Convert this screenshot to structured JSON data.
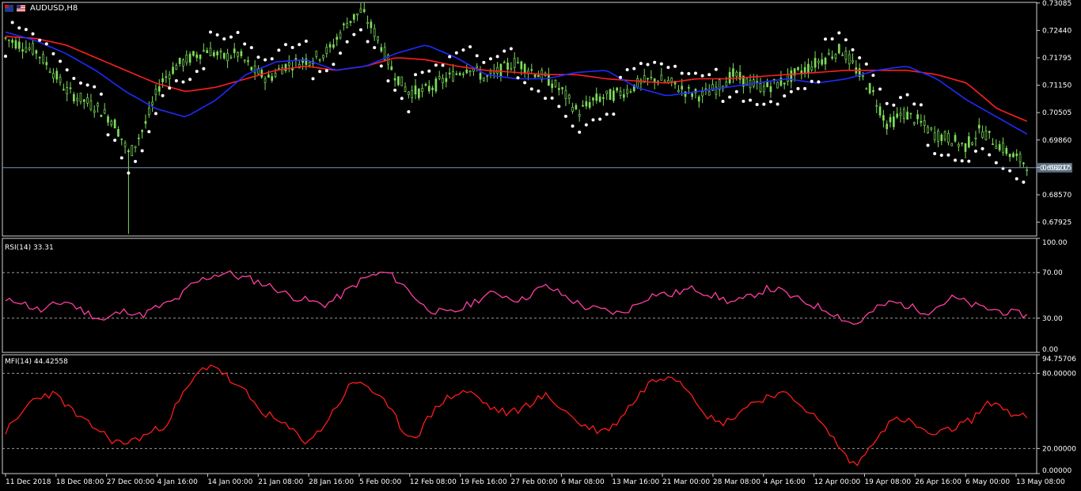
{
  "window": {
    "symbol_title": "AUDUSD,H8"
  },
  "icons": {
    "flag_left": "australia-flag-icon",
    "flag_right": "us-flag-icon"
  },
  "colors": {
    "background": "#000000",
    "candle": "#7ddc5a",
    "sar": "#ffffff",
    "ma_fast": "#1f2bff",
    "ma_slow": "#ff1e1e",
    "rsi": "#ff3fa0",
    "mfi": "#ff1a1a",
    "grid": "#9a9a9a",
    "price_line": "#7894a8"
  },
  "chart_data": [
    {
      "type": "candlestick",
      "title": "AUDUSD,H8",
      "indicators": [
        "Parabolic SAR",
        "Moving Average (fast)",
        "Moving Average (slow)"
      ],
      "ylim": [
        0.676,
        0.731
      ],
      "y_ticks": [
        "0.73085",
        "0.72440",
        "0.71795",
        "0.71150",
        "0.70505",
        "0.69860",
        "0.69215",
        "0.68570",
        "0.67925"
      ],
      "current_price": "0.69207",
      "x_ticks": [
        "11 Dec 2018",
        "18 Dec 08:00",
        "27 Dec 00:00",
        "4 Jan 16:00",
        "14 Jan 00:00",
        "21 Jan 08:00",
        "28 Jan 16:00",
        "5 Feb 00:00",
        "12 Feb 08:00",
        "19 Feb 16:00",
        "27 Feb 00:00",
        "6 Mar 08:00",
        "13 Mar 16:00",
        "21 Mar 00:00",
        "28 Mar 08:00",
        "4 Apr 16:00",
        "12 Apr 00:00",
        "19 Apr 08:00",
        "26 Apr 16:00",
        "6 May 00:00",
        "13 May 08:00"
      ],
      "close_path": [
        0.7225,
        0.721,
        0.7195,
        0.715,
        0.71,
        0.708,
        0.706,
        0.703,
        0.695,
        0.702,
        0.712,
        0.716,
        0.718,
        0.72,
        0.718,
        0.719,
        0.715,
        0.713,
        0.716,
        0.717,
        0.718,
        0.72,
        0.726,
        0.729,
        0.723,
        0.715,
        0.71,
        0.71,
        0.712,
        0.714,
        0.716,
        0.713,
        0.715,
        0.717,
        0.715,
        0.713,
        0.71,
        0.705,
        0.708,
        0.709,
        0.71,
        0.712,
        0.713,
        0.712,
        0.71,
        0.709,
        0.711,
        0.714,
        0.712,
        0.711,
        0.712,
        0.714,
        0.716,
        0.718,
        0.72,
        0.715,
        0.71,
        0.702,
        0.705,
        0.703,
        0.7,
        0.699,
        0.697,
        0.701,
        0.698,
        0.695,
        0.693
      ],
      "low_spike": {
        "at_index": 8,
        "low": 0.6765
      },
      "ma_slow": [
        0.723,
        0.7225,
        0.721,
        0.718,
        0.715,
        0.712,
        0.71,
        0.711,
        0.713,
        0.715,
        0.716,
        0.715,
        0.716,
        0.718,
        0.7175,
        0.716,
        0.715,
        0.7145,
        0.714,
        0.714,
        0.713,
        0.7125,
        0.712,
        0.713,
        0.713,
        0.7135,
        0.714,
        0.7145,
        0.715,
        0.715,
        0.715,
        0.714,
        0.712,
        0.706,
        0.703
      ],
      "ma_fast": [
        0.724,
        0.722,
        0.719,
        0.715,
        0.71,
        0.706,
        0.704,
        0.708,
        0.714,
        0.717,
        0.7175,
        0.715,
        0.716,
        0.719,
        0.721,
        0.718,
        0.714,
        0.713,
        0.713,
        0.7145,
        0.715,
        0.711,
        0.709,
        0.71,
        0.711,
        0.712,
        0.713,
        0.712,
        0.713,
        0.715,
        0.716,
        0.713,
        0.708,
        0.704,
        0.7
      ]
    },
    {
      "type": "line",
      "title": "RSI(14) 33.31",
      "ylim": [
        0,
        100
      ],
      "y_ticks": [
        "100.00",
        "70.00",
        "30.00",
        "0.00"
      ],
      "levels": [
        70,
        30
      ],
      "values": [
        44,
        46,
        40,
        36,
        42,
        45,
        38,
        33,
        28,
        34,
        37,
        32,
        38,
        42,
        47,
        58,
        64,
        68,
        70,
        66,
        64,
        60,
        56,
        50,
        47,
        44,
        42,
        48,
        56,
        64,
        68,
        70,
        62,
        52,
        40,
        36,
        34,
        38,
        44,
        50,
        52,
        48,
        46,
        54,
        58,
        52,
        46,
        40,
        38,
        36,
        34,
        40,
        48,
        52,
        50,
        54,
        56,
        52,
        48,
        44,
        46,
        52,
        56,
        54,
        48,
        44,
        40,
        36,
        30,
        24,
        32,
        40,
        44,
        42,
        38,
        36,
        42,
        48,
        44,
        40,
        38,
        36,
        34,
        33.31
      ]
    },
    {
      "type": "line",
      "title": "MFI(14) 44.42558",
      "ylim": [
        0,
        94.75706
      ],
      "y_ticks": [
        "94.75706",
        "80.00000",
        "20.00000",
        "0.00000"
      ],
      "levels": [
        80,
        20
      ],
      "values": [
        34,
        42,
        56,
        62,
        64,
        58,
        48,
        40,
        36,
        28,
        24,
        26,
        30,
        34,
        40,
        56,
        70,
        82,
        88,
        80,
        70,
        64,
        52,
        46,
        40,
        34,
        26,
        30,
        42,
        56,
        70,
        74,
        66,
        56,
        44,
        30,
        32,
        46,
        58,
        62,
        66,
        62,
        54,
        50,
        48,
        52,
        58,
        62,
        56,
        48,
        40,
        36,
        34,
        38,
        50,
        60,
        72,
        76,
        80,
        72,
        62,
        48,
        40,
        42,
        50,
        56,
        60,
        64,
        62,
        58,
        50,
        40,
        30,
        16,
        6,
        16,
        32,
        40,
        44,
        40,
        34,
        30,
        34,
        38,
        42,
        50,
        58,
        52,
        46,
        44.42558
      ]
    }
  ]
}
